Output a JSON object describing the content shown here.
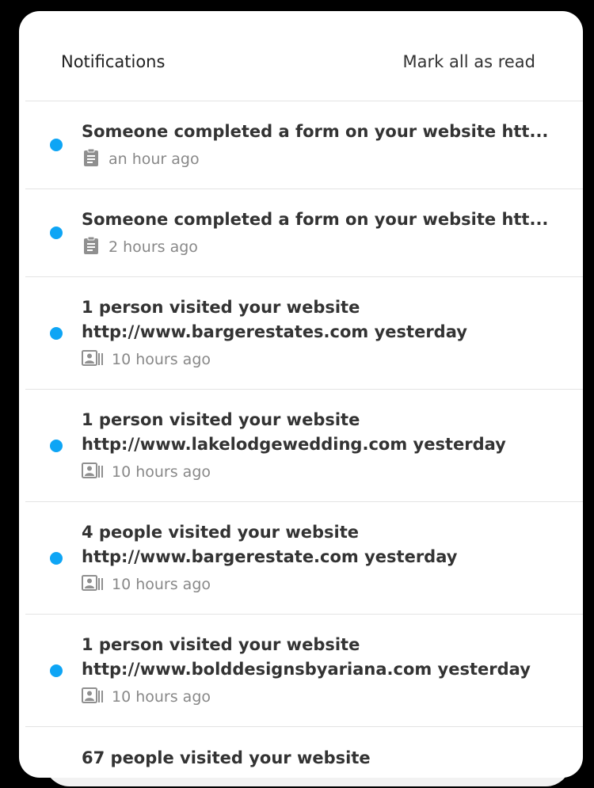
{
  "header": {
    "title": "Notifications",
    "mark_all_label": "Mark all as read"
  },
  "colors": {
    "unread_dot": "#0ea5f5",
    "text_primary": "#333333",
    "text_muted": "#888888"
  },
  "notifications": [
    {
      "line1": "Someone completed a form on your website htt...",
      "line2": "",
      "time": "an hour ago",
      "icon": "clipboard-icon",
      "unread": true
    },
    {
      "line1": "Someone completed a form on your website htt...",
      "line2": "",
      "time": "2 hours ago",
      "icon": "clipboard-icon",
      "unread": true
    },
    {
      "line1": "1 person visited your website",
      "line2": "http://www.bargerestates.com yesterday",
      "time": "10 hours ago",
      "icon": "contact-card-icon",
      "unread": true
    },
    {
      "line1": "1 person visited your website",
      "line2": "http://www.lakelodgewedding.com yesterday",
      "time": "10 hours ago",
      "icon": "contact-card-icon",
      "unread": true
    },
    {
      "line1": "4 people visited your website",
      "line2": "http://www.bargerestate.com yesterday",
      "time": "10 hours ago",
      "icon": "contact-card-icon",
      "unread": true
    },
    {
      "line1": "1 person visited your website",
      "line2": "http://www.bolddesignsbyariana.com yesterday",
      "time": "10 hours ago",
      "icon": "contact-card-icon",
      "unread": true
    },
    {
      "line1": "67 people visited your website",
      "line2": "",
      "time": "",
      "icon": "",
      "unread": false
    }
  ]
}
